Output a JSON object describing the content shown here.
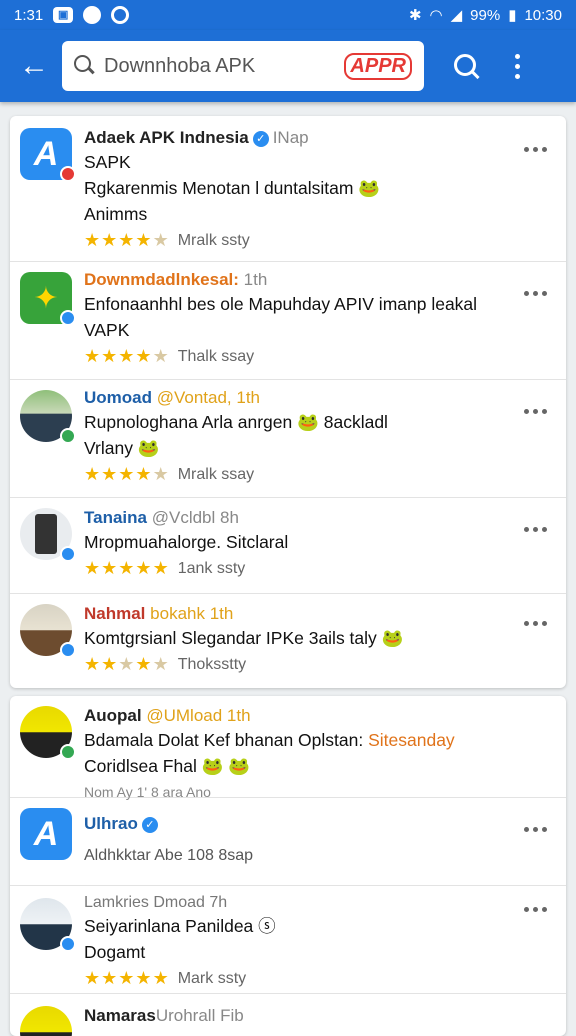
{
  "status": {
    "time_left": "1:31",
    "battery": "99%",
    "time_right": "10:30",
    "icons": [
      "gallery-icon",
      "chat-icon",
      "settings-icon",
      "bluetooth-icon",
      "wifi-icon",
      "signal-icon",
      "battery-icon"
    ]
  },
  "toolbar": {
    "search_text": "Downnhoba APK",
    "apk_badge": "APPR"
  },
  "card1": [
    {
      "name": "Adaek APK Indnesia",
      "handle": "INap",
      "text1": "SAPK",
      "text2": "Rgkarenmis Menotan l duntalsitam 🐸",
      "text3": "Animms",
      "rating": 4,
      "rating_label": "Mralk ssty"
    },
    {
      "name": "Downmdadlnkesal:",
      "handle": "1th",
      "text1": "Enfonaanhhl bes ole Mapuhday APIV imanp leakal",
      "text2": "VAPK",
      "rating": 4,
      "rating_label": "Thalk ssay"
    },
    {
      "name": "Uomoad",
      "handle": "@Vontad, 1th",
      "text1": "Rupnologhana Arla anrgen 🐸 8ackladl",
      "text2": "Vrlany 🐸",
      "rating": 4,
      "rating_label": "Mralk ssay"
    },
    {
      "name": "Tanaina",
      "handle": "@Vcldbl 8h",
      "text1": "Mropmuahalorge. Sitclaral",
      "rating": 5,
      "rating_label": "1ank ssty"
    },
    {
      "name": "Nahmal",
      "handle": "bokahk 1th",
      "text1": "Komtgrsianl Slegandar IPKe 3ails taly 🐸",
      "rating": 3,
      "rating_label": "Thoksstty"
    }
  ],
  "card2": [
    {
      "name": "Auopal",
      "handle": "@UMload 1th",
      "text1": "Bdamala Dolat Kef bhanan Oplstan:",
      "text1b": "Sitesanday",
      "text2": "Coridlsea Fhal 🐸 🐸",
      "text3": "Nom Ay 1' 8 ara Ano"
    },
    {
      "name": "Ulhrao",
      "text1": "Aldhkktar Abe 108 8sap"
    },
    {
      "name": "Lamkries Dmoad 7h",
      "text1": "Seiyarinlana Panildea ⓢ",
      "text2": "Dogamt",
      "rating": 5,
      "rating_label": "Mark ssty"
    },
    {
      "name": "Namaras",
      "handle": "Urohrall Fib"
    }
  ]
}
